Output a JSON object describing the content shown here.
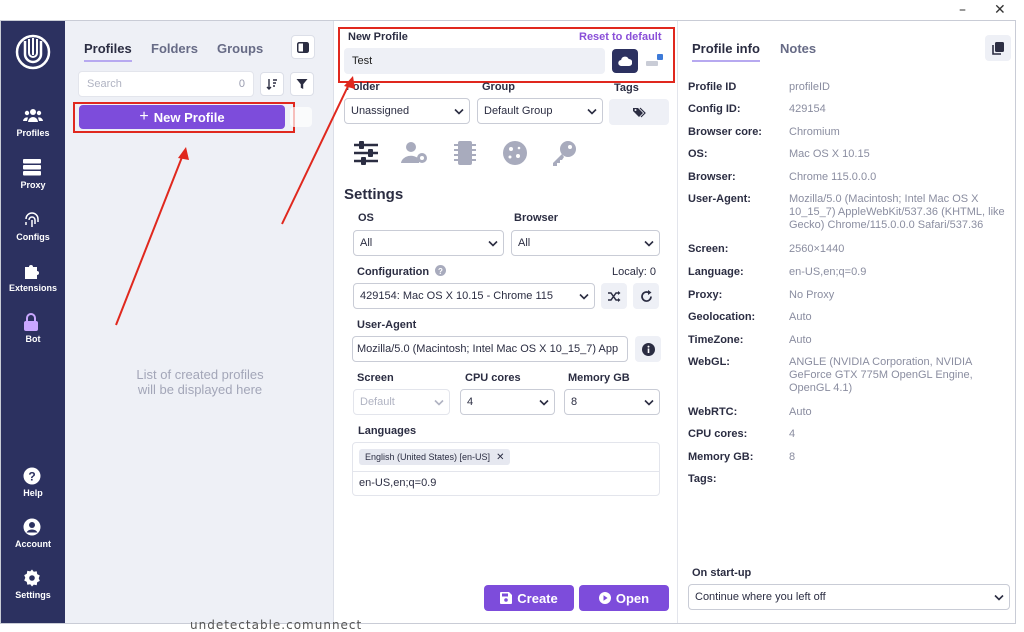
{
  "window": {
    "minimize": "–",
    "close": "✕"
  },
  "nav": {
    "items": [
      {
        "label": "Profiles",
        "icon": "users-icon"
      },
      {
        "label": "Proxy",
        "icon": "server-icon"
      },
      {
        "label": "Configs",
        "icon": "fingerprint-icon"
      },
      {
        "label": "Extensions",
        "icon": "puzzle-icon"
      },
      {
        "label": "Bot",
        "icon": "lock-icon"
      },
      {
        "label": "Help",
        "icon": "question-icon"
      },
      {
        "label": "Account",
        "icon": "account-icon"
      },
      {
        "label": "Settings",
        "icon": "gear-icon"
      }
    ]
  },
  "profiles_panel": {
    "tabs": [
      "Profiles",
      "Folders",
      "Groups"
    ],
    "search_placeholder": "Search",
    "count": "0",
    "new_profile_label": "New Profile",
    "empty_message_line1": "List of created profiles",
    "empty_message_line2": "will be displayed here"
  },
  "form": {
    "name_label": "New Profile",
    "reset_label": "Reset to default",
    "name_value": "Test",
    "folder_label": "Folder",
    "folder_value": "Unassigned",
    "group_label": "Group",
    "group_value": "Default Group",
    "tags_label": "Tags",
    "settings_title": "Settings",
    "os_label": "OS",
    "os_value": "All",
    "browser_label": "Browser",
    "browser_value": "All",
    "configuration_label": "Configuration",
    "locally_label": "Localy: 0",
    "configuration_value": "429154: Mac OS X 10.15 - Chrome 115",
    "useragent_label": "User-Agent",
    "useragent_value": "Mozilla/5.0 (Macintosh; Intel Mac OS X 10_15_7) App",
    "screen_label": "Screen",
    "screen_value": "Default",
    "cpu_label": "CPU cores",
    "cpu_value": "4",
    "memory_label": "Memory GB",
    "memory_value": "8",
    "languages_label": "Languages",
    "language_chip": "English (United States) [en-US]",
    "languages_value": "en-US,en;q=0.9",
    "create_label": "Create",
    "open_label": "Open"
  },
  "info_panel": {
    "tabs": [
      "Profile info",
      "Notes"
    ],
    "rows": [
      {
        "k": "Profile ID",
        "v": "profileID"
      },
      {
        "k": "Config ID:",
        "v": "429154"
      },
      {
        "k": "Browser core:",
        "v": "Chromium"
      },
      {
        "k": "OS:",
        "v": "Mac OS X 10.15"
      },
      {
        "k": "Browser:",
        "v": "Chrome 115.0.0.0"
      },
      {
        "k": "User-Agent:",
        "v": "Mozilla/5.0 (Macintosh; Intel Mac OS X 10_15_7) AppleWebKit/537.36 (KHTML, like Gecko) Chrome/115.0.0.0 Safari/537.36"
      },
      {
        "k": "Screen:",
        "v": "2560×1440"
      },
      {
        "k": "Language:",
        "v": "en-US,en;q=0.9"
      },
      {
        "k": "Proxy:",
        "v": "No Proxy"
      },
      {
        "k": "Geolocation:",
        "v": "Auto"
      },
      {
        "k": "TimeZone:",
        "v": "Auto"
      },
      {
        "k": "WebGL:",
        "v": "ANGLE (NVIDIA Corporation, NVIDIA GeForce GTX 775M OpenGL Engine, OpenGL 4.1)"
      },
      {
        "k": "WebRTC:",
        "v": "Auto"
      },
      {
        "k": "CPU cores:",
        "v": "4"
      },
      {
        "k": "Memory GB:",
        "v": "8"
      },
      {
        "k": "Tags:",
        "v": ""
      }
    ],
    "startup_label": "On start-up",
    "startup_value": "Continue where you left off"
  },
  "footer_fragment": "undetectable.comunnect",
  "colors": {
    "accent": "#7d4cdb",
    "nav_bg": "#2c3160",
    "annotation": "#e0281e"
  }
}
